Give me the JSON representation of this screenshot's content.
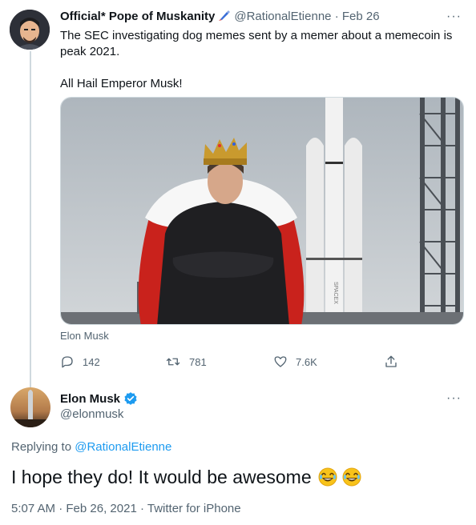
{
  "parent_tweet": {
    "display_name": "Official* Pope of Muskanity",
    "handle": "@RationalEtienne",
    "separator": "·",
    "date": "Feb 26",
    "text_line1": "The SEC investigating dog memes sent by a memer about a memecoin is peak 2021.",
    "text_line2": "All Hail Emperor Musk!",
    "media_caption": "Elon Musk",
    "media_watermark": "SPACEX",
    "replies": "142",
    "retweets": "781",
    "likes": "7.6K",
    "more_label": "···"
  },
  "reply_tweet": {
    "display_name": "Elon Musk",
    "handle": "@elonmusk",
    "replying_prefix": "Replying to",
    "replying_to": "@RationalEtienne",
    "text": "I hope they do! It would be awesome",
    "time": "5:07 AM",
    "date": "Feb 26, 2021",
    "source": "Twitter for iPhone",
    "more_label": "···"
  },
  "icons": [
    "brush-icon",
    "more-icon",
    "reply-icon",
    "retweet-icon",
    "like-icon",
    "share-icon",
    "verified-badge-icon",
    "laughing-emoji-icon"
  ],
  "colors": {
    "accent": "#1d9bf0",
    "muted": "#536471",
    "text": "#0f1419",
    "thread_line": "#cfd9de"
  }
}
